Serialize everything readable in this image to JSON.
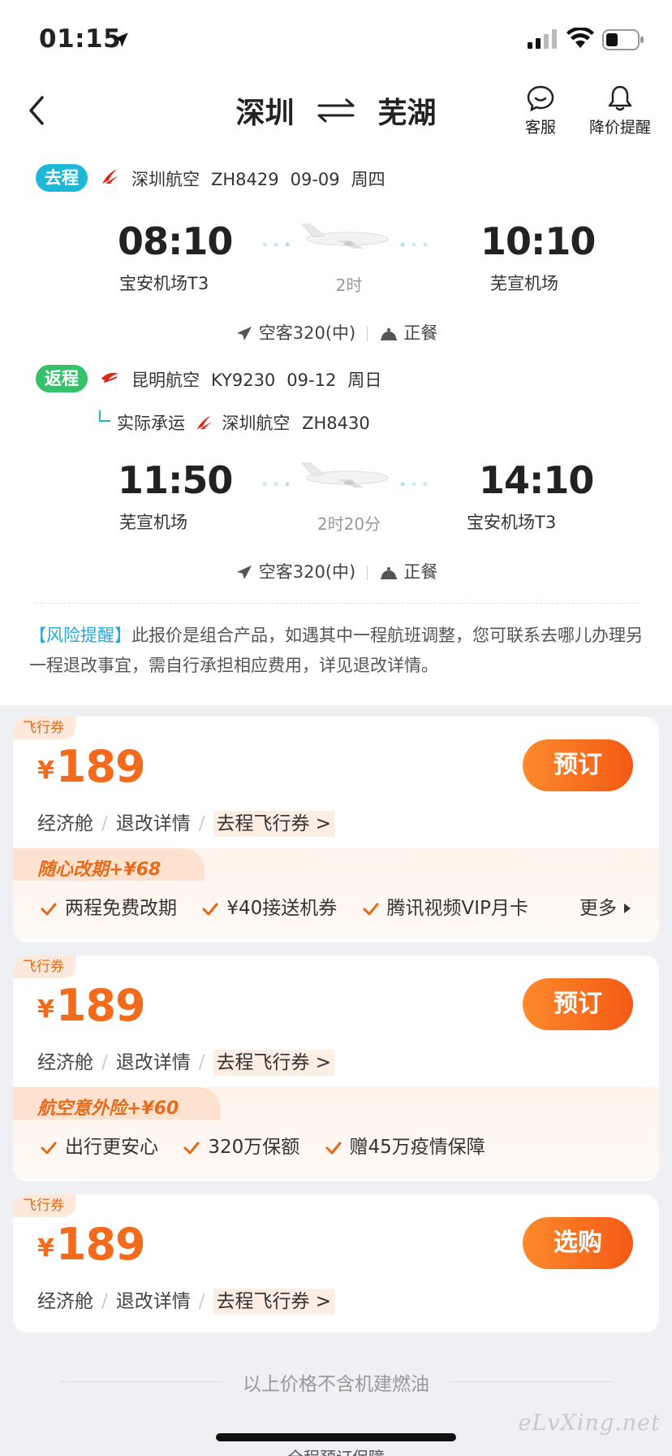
{
  "status_bar": {
    "time": "01:15"
  },
  "nav": {
    "from": "深圳",
    "to": "芜湖",
    "service_label": "客服",
    "alert_label": "降价提醒"
  },
  "outbound": {
    "tag": "去程",
    "airline": "深圳航空",
    "flight_no": "ZH8429",
    "date": "09-09",
    "weekday": "周四",
    "dep_time": "08:10",
    "dep_airport": "宝安机场T3",
    "duration": "2时",
    "arr_time": "10:10",
    "arr_airport": "芜宣机场",
    "aircraft": "空客320(中)",
    "meal": "正餐"
  },
  "return": {
    "tag": "返程",
    "airline": "昆明航空",
    "flight_no": "KY9230",
    "date": "09-12",
    "weekday": "周日",
    "operated_prefix": "实际承运",
    "operated_airline": "深圳航空",
    "operated_flight_no": "ZH8430",
    "dep_time": "11:50",
    "dep_airport": "芜宣机场",
    "duration": "2时20分",
    "arr_time": "14:10",
    "arr_airport": "宝安机场T3",
    "aircraft": "空客320(中)",
    "meal": "正餐"
  },
  "risk": {
    "label": "【风险提醒】",
    "text": "此报价是组合产品，如遇其中一程航班调整，您可联系去哪儿办理另一程退改事宜，需自行承担相应费用，详见退改详情。"
  },
  "cards": [
    {
      "ticket_tag": "飞行券",
      "currency": "¥",
      "price": "189",
      "button": "预订",
      "cabin": "经济舱",
      "refund": "退改详情",
      "voucher": "去程飞行券 >",
      "addon_title": "随心改期+¥68",
      "benefits": [
        "两程免费改期",
        "¥40接送机券",
        "腾讯视频VIP月卡"
      ],
      "more": "更多"
    },
    {
      "ticket_tag": "飞行券",
      "currency": "¥",
      "price": "189",
      "button": "预订",
      "cabin": "经济舱",
      "refund": "退改详情",
      "voucher": "去程飞行券 >",
      "addon_title": "航空意外险+¥60",
      "benefits": [
        "出行更安心",
        "320万保额",
        "赠45万疫情保障"
      ]
    },
    {
      "ticket_tag": "飞行券",
      "currency": "¥",
      "price": "189",
      "button": "选购",
      "cabin": "经济舱",
      "refund": "退改详情",
      "voucher": "去程飞行券 >"
    }
  ],
  "footer": {
    "note": "以上价格不含机建燃油",
    "watermark": "eLvXing.net",
    "bottom_peek": "全程预订保障"
  },
  "colors": {
    "accent_orange": "#f26a1b",
    "outbound_tag": "#1fb7d8",
    "return_tag": "#35c26a",
    "risk_highlight": "#2aa8d6"
  }
}
